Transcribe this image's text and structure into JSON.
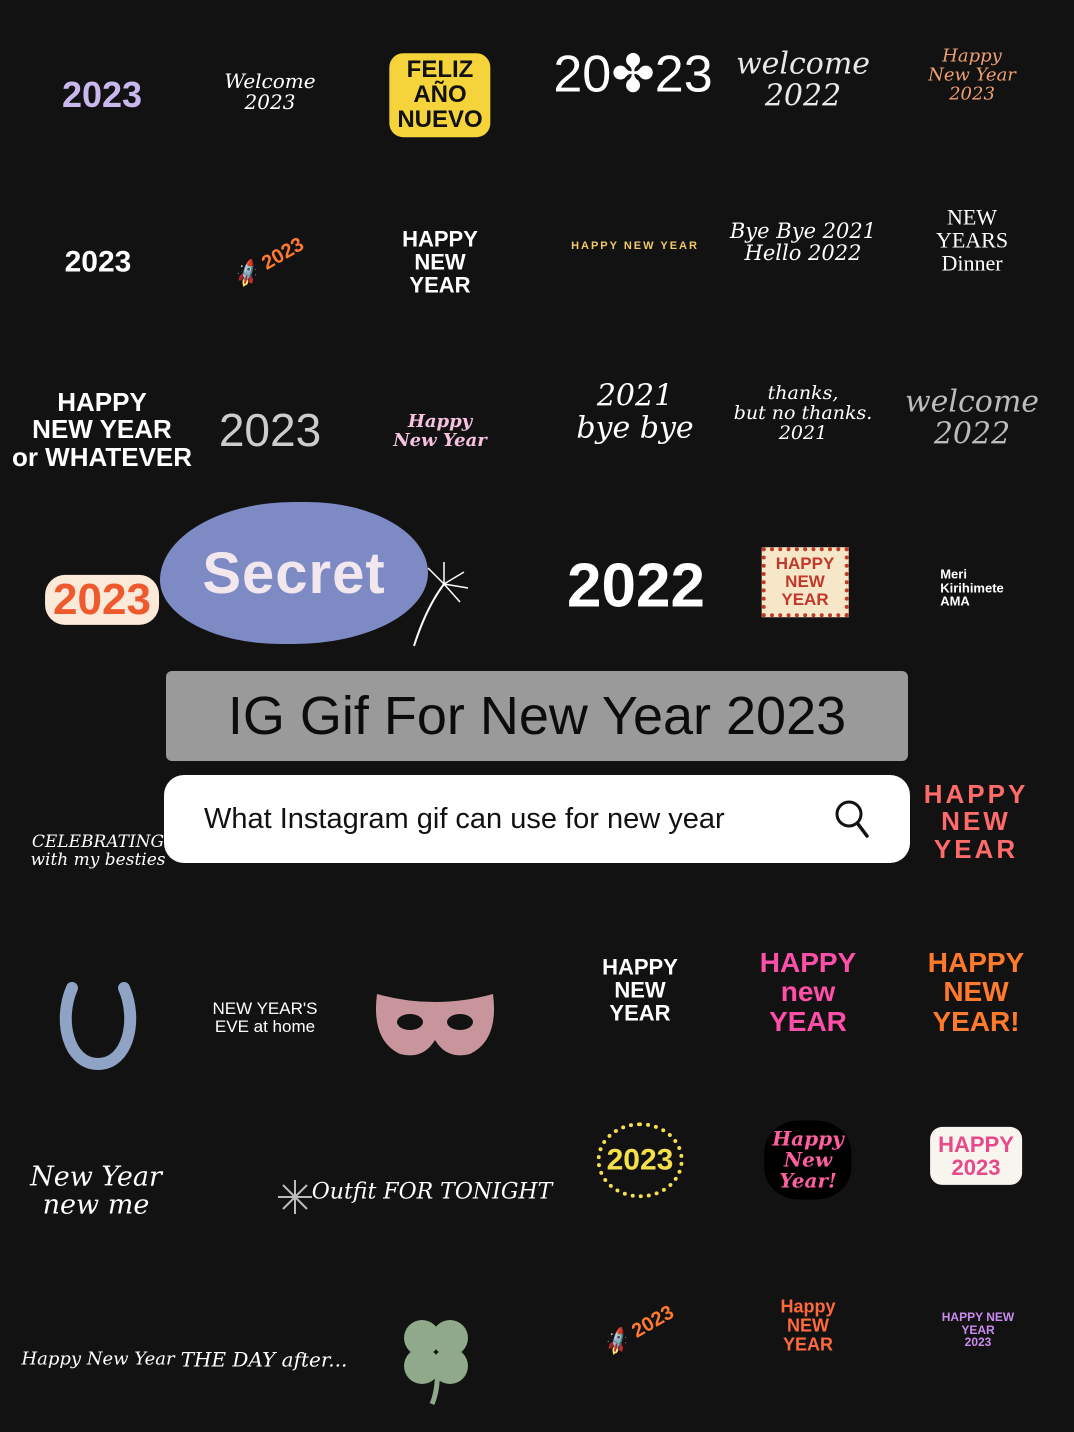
{
  "title": "IG Gif For New Year 2023",
  "search": {
    "query": "What Instagram gif can use for new year",
    "icon": "search-icon"
  },
  "secret_label": "Secret",
  "stickers": [
    {
      "text": "2023",
      "color": "#c9b8ee"
    },
    {
      "text": "Welcome\n2023",
      "color": "#ffffff"
    },
    {
      "text": "FELIZ\nAÑO\nNUEVO",
      "color": "#111111"
    },
    {
      "text": "20✤23",
      "color": "#ffffff"
    },
    {
      "text": "welcome\n2022",
      "color": "#e8e8e8"
    },
    {
      "text": "Happy New Year 2023",
      "color": "#f0a070"
    },
    {
      "text": "2023",
      "color": "#ffffff"
    },
    {
      "text": "🚀 2023",
      "color": "#ff7a30"
    },
    {
      "text": "HAPPY\nNEW\nYEAR",
      "color": "#ffffff"
    },
    {
      "text": "HAPPY NEW YEAR",
      "color": "#f2c96a"
    },
    {
      "text": "Bye Bye 2021\nHello 2022",
      "color": "#f5f5f5"
    },
    {
      "text": "NEW YEARS\nDinner",
      "color": "#ffffff"
    },
    {
      "text": "HAPPY\nNEW YEAR\nor WHATEVER",
      "color": "#ffffff"
    },
    {
      "text": "2023",
      "color": "#cccccc"
    },
    {
      "text": "Happy\nNew Year",
      "color": "#f6c2e0"
    },
    {
      "text": "2021\nbye bye",
      "color": "#ffffff"
    },
    {
      "text": "thanks,\nbut no thanks.\n2021",
      "color": "#ffffff"
    },
    {
      "text": "welcome\n2022",
      "color": "#bbbbbb"
    },
    {
      "text": "2023",
      "color": "#ee5a2e"
    },
    {
      "text": "2022",
      "color": "#ffffff"
    },
    {
      "text": "HAPPY\nNEW\nYEAR",
      "color": "#c0392b"
    },
    {
      "text": "Meri\nKirihimete\nAMA",
      "color": "#ffffff"
    },
    {
      "text": "CELEBRATING\nwith my besties",
      "color": "#ffffff"
    },
    {
      "text": "HAPPY\nNEW\nYEAR",
      "color": "#ff6b6b"
    },
    {
      "text": "NEW YEAR'S\nEVE at home",
      "color": "#ffffff"
    },
    {
      "text": "HAPPY\nNEW\nYEAR",
      "color": "#ffffff"
    },
    {
      "text": "HAPPY\nnew\nYEAR",
      "color": "#ff4fa8"
    },
    {
      "text": "HAPPY\nNEW\nYEAR!",
      "color": "#ff7a2a"
    },
    {
      "text": "New Year\nnew me",
      "color": "#ffffff"
    },
    {
      "text": "Outfit FOR TONIGHT",
      "color": "#ffffff"
    },
    {
      "text": "2023",
      "color": "#f5e04a"
    },
    {
      "text": "Happy\nNew\nYear!",
      "color": "#ff5fa0"
    },
    {
      "text": "HAPPY\n2023",
      "color": "#e64a8a"
    },
    {
      "text": "Happy New Year",
      "color": "#ffffff"
    },
    {
      "text": "THE DAY after...",
      "color": "#ffffff"
    },
    {
      "text": "🚀 2023",
      "color": "#ff7a30"
    },
    {
      "text": "Happy\nNEW\nYEAR",
      "color": "#ff6a3d"
    },
    {
      "text": "HAPPY NEW YEAR\n2023",
      "color": "#c98bf0"
    }
  ],
  "icons": [
    "horseshoe-icon",
    "mask-icon",
    "clover-icon",
    "firework-icon",
    "sparkler-icon"
  ]
}
